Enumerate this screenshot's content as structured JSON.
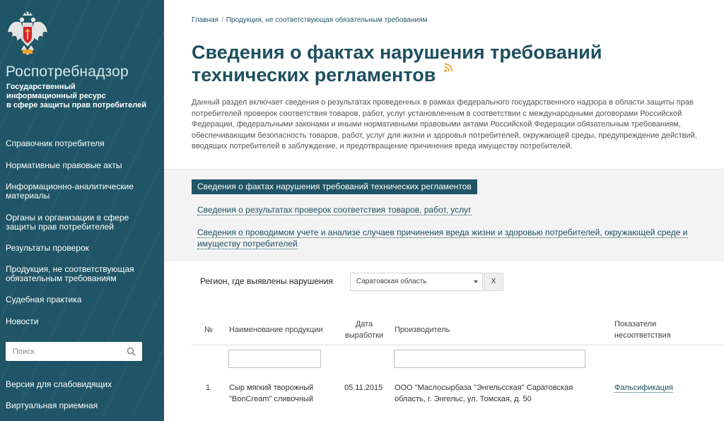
{
  "sidebar": {
    "brand": "Роспотребнадзор",
    "brand_sub": [
      "Государственный",
      "информационный ресурс",
      "в сфере защиты прав потребителей"
    ],
    "nav": [
      {
        "label": "Справочник потребителя"
      },
      {
        "label": "Нормативные правовые акты"
      },
      {
        "label": "Информационно-аналитические материалы"
      },
      {
        "label": "Органы и организации в сфере защиты прав потребителей"
      },
      {
        "label": "Результаты проверок"
      },
      {
        "label": "Продукция, не соответствующая обязательным требованиям"
      },
      {
        "label": "Судебная практика"
      },
      {
        "label": "Новости"
      }
    ],
    "search_placeholder": "Поиск",
    "bottom_links": [
      {
        "label": "Версия для слабовидящих"
      },
      {
        "label": "Виртуальная приемная"
      }
    ]
  },
  "breadcrumb": {
    "home": "Главная",
    "separator": "/",
    "current": "Продукция, не соответствующая обязательным требованиям"
  },
  "page_title": "Сведения о фактах нарушения требований технических регламентов",
  "intro": "Данный раздел включает сведения о результатах проведенных в рамках федерального государственного надзора в области защиты прав потребителей проверок соответствия товаров, работ, услуг установленным в соответствии с международными договорами Российской Федерации, федеральными законами и иными нормативными правовыми актами Российской Федерации обязательным требованиям, обеспечивающим безопасность товаров, работ, услуг для жизни и здоровья потребителей, окружающей среды, предупреждение действий, вводящих потребителей в заблуждение, и предотвращение причинения вреда имуществу потребителей.",
  "tabs": {
    "active": "Сведения о фактах нарушения требований технических регламентов",
    "link1": "Сведения о результатах проверок соответствия товаров, работ, услуг",
    "link2": "Сведения о проводимом учете и анализе случаев причинения вреда жизни и здоровью потребителей, окружающей среде и имуществу потребителей"
  },
  "filter": {
    "region_label": "Регион, где выявлены нарушения",
    "region_value": "Саратовская область",
    "clear_label": "X"
  },
  "table": {
    "headers": {
      "num": "№",
      "product": "Наименование продукции",
      "date": "Дата выработки",
      "manufacturer": "Производитель",
      "indicators": "Показатели несоответствия"
    },
    "rows": [
      {
        "num": "1",
        "product": "Сыр мягкий творожный \"BonCream\" сливочный",
        "date": "05.11.2015",
        "manufacturer": "ООО \"Маслосырбаза \"Энгельсская\" Саратовская область, г. Энгельс, ул. Томская, д. 50",
        "indicator": "Фальсификация"
      }
    ]
  },
  "colors": {
    "sidebar_bg": "#1f5566",
    "accent": "#1f4f5f",
    "rss": "#f0a030"
  }
}
